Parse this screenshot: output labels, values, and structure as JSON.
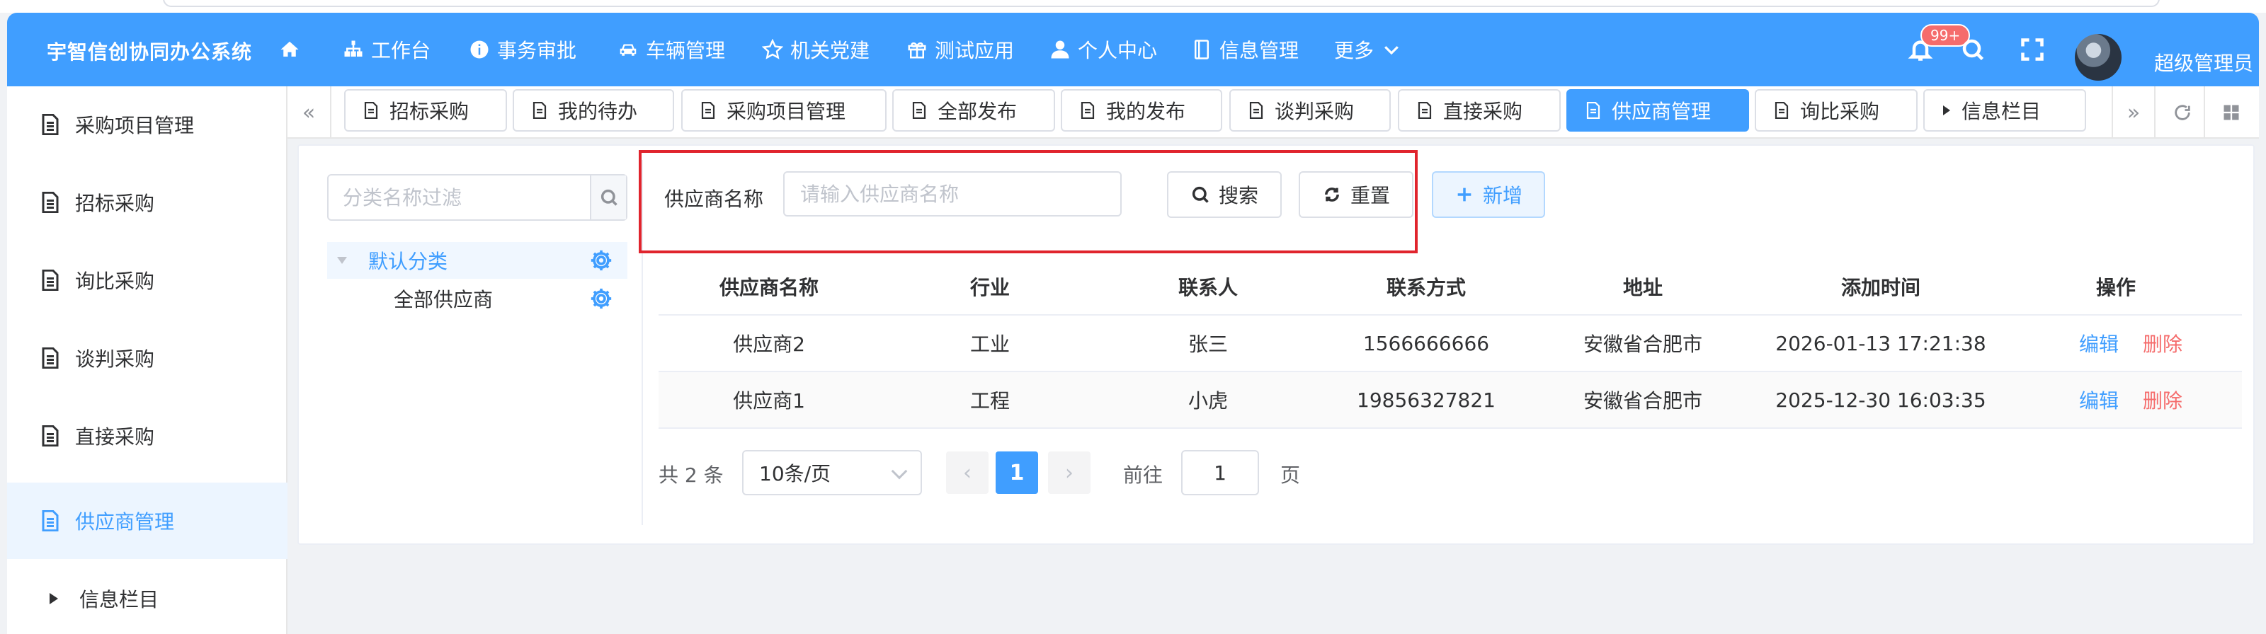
{
  "app": {
    "title": "宇智信创协同办公系统",
    "user_name": "超级管理员",
    "notification_count": "99+",
    "accent_color": "#409eff"
  },
  "topnav": [
    {
      "label": "",
      "icon": "home-icon"
    },
    {
      "label": "工作台",
      "icon": "sitemap-icon"
    },
    {
      "label": "事务审批",
      "icon": "info-icon"
    },
    {
      "label": "车辆管理",
      "icon": "car-icon"
    },
    {
      "label": "机关党建",
      "icon": "star-icon"
    },
    {
      "label": "测试应用",
      "icon": "gift-icon"
    },
    {
      "label": "个人中心",
      "icon": "user-icon"
    },
    {
      "label": "信息管理",
      "icon": "document-icon"
    },
    {
      "label": "更多",
      "icon": "chevron-down-icon"
    }
  ],
  "sidebar": {
    "items": [
      {
        "label": "采购项目管理"
      },
      {
        "label": "招标采购"
      },
      {
        "label": "询比采购"
      },
      {
        "label": "谈判采购"
      },
      {
        "label": "直接采购"
      },
      {
        "label": "供应商管理",
        "active": true
      },
      {
        "label": "信息栏目",
        "collapsed": true
      }
    ]
  },
  "tabs": [
    {
      "label": "招标采购"
    },
    {
      "label": "我的待办"
    },
    {
      "label": "采购项目管理"
    },
    {
      "label": "全部发布"
    },
    {
      "label": "我的发布"
    },
    {
      "label": "谈判采购"
    },
    {
      "label": "直接采购"
    },
    {
      "label": "供应商管理",
      "active": true
    },
    {
      "label": "询比采购"
    },
    {
      "label": "信息栏目"
    }
  ],
  "category_panel": {
    "filter_placeholder": "分类名称过滤",
    "tree": [
      {
        "label": "默认分类",
        "selected": true
      },
      {
        "label": "全部供应商"
      }
    ]
  },
  "search": {
    "label": "供应商名称",
    "placeholder": "请输入供应商名称",
    "search_button": "搜索",
    "reset_button": "重置",
    "add_button": "新增"
  },
  "table": {
    "columns": [
      "供应商名称",
      "行业",
      "联系人",
      "联系方式",
      "地址",
      "添加时间",
      "操作"
    ],
    "rows": [
      {
        "name": "供应商2",
        "industry": "工业",
        "contact": "张三",
        "phone": "1566666666",
        "address": "安徽省合肥市",
        "time": "2026-01-13 17:21:38"
      },
      {
        "name": "供应商1",
        "industry": "工程",
        "contact": "小虎",
        "phone": "19856327821",
        "address": "安徽省合肥市",
        "time": "2025-12-30 16:03:35"
      }
    ],
    "edit_label": "编辑",
    "delete_label": "删除"
  },
  "pagination": {
    "total_text": "共 2 条",
    "page_size": "10条/页",
    "prev": "‹",
    "current_page": "1",
    "next": "›",
    "goto_label": "前往",
    "goto_value": "1",
    "page_unit": "页"
  }
}
